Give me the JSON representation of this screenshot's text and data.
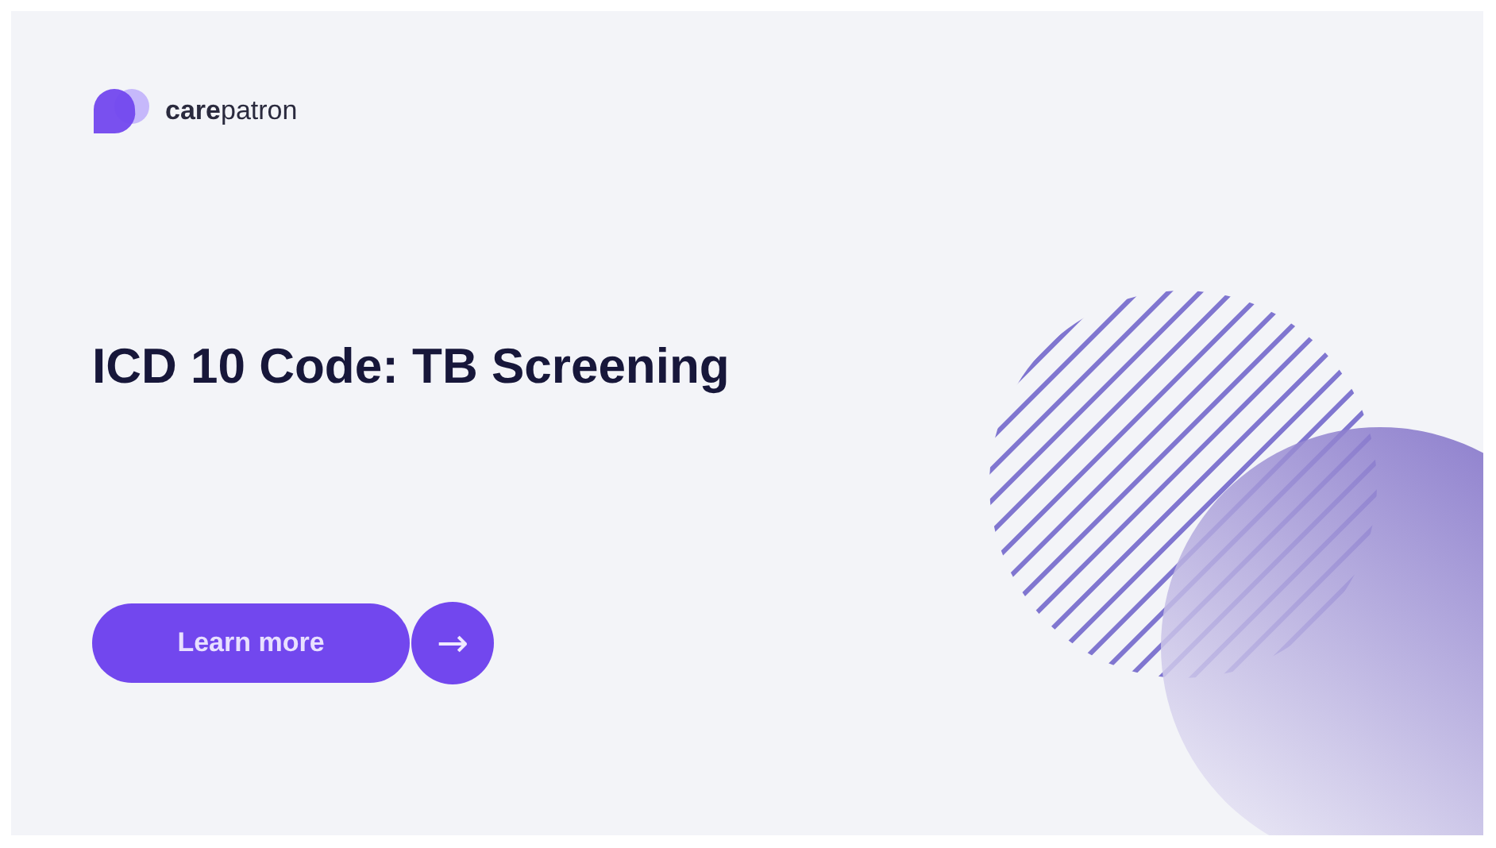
{
  "brand": {
    "name": "**care**patron"
  },
  "headline": "ICD 10 Code: TB Screening",
  "cta": {
    "label": "Learn more",
    "arrow": "→"
  }
}
